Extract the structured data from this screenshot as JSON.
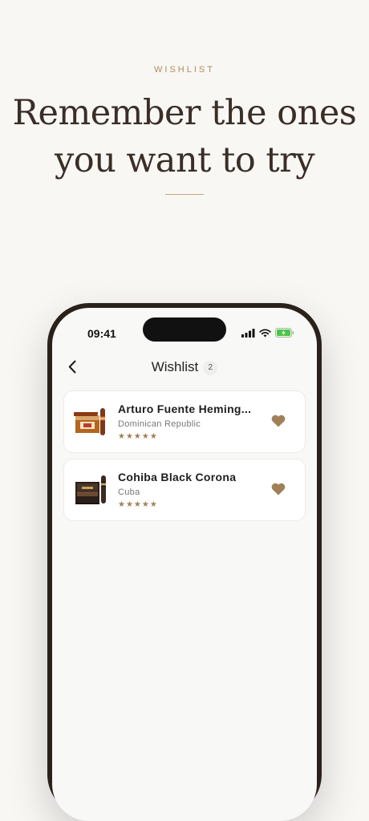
{
  "header": {
    "eyebrow": "WISHLIST",
    "headline_line1": "Remember the ones",
    "headline_line2": "you want to try"
  },
  "status_bar": {
    "time": "09:41"
  },
  "nav": {
    "title": "Wishlist",
    "count": "2"
  },
  "items": [
    {
      "name": "Arturo Fuente Heming...",
      "origin": "Dominican Republic",
      "stars": "★★★★★",
      "rating": 5
    },
    {
      "name": "Cohiba Black Corona",
      "origin": "Cuba",
      "stars": "★★★★★",
      "rating": 5
    }
  ],
  "colors": {
    "accent": "#b08d5a",
    "heart": "#a08056",
    "phone_frame": "#2a211b"
  }
}
